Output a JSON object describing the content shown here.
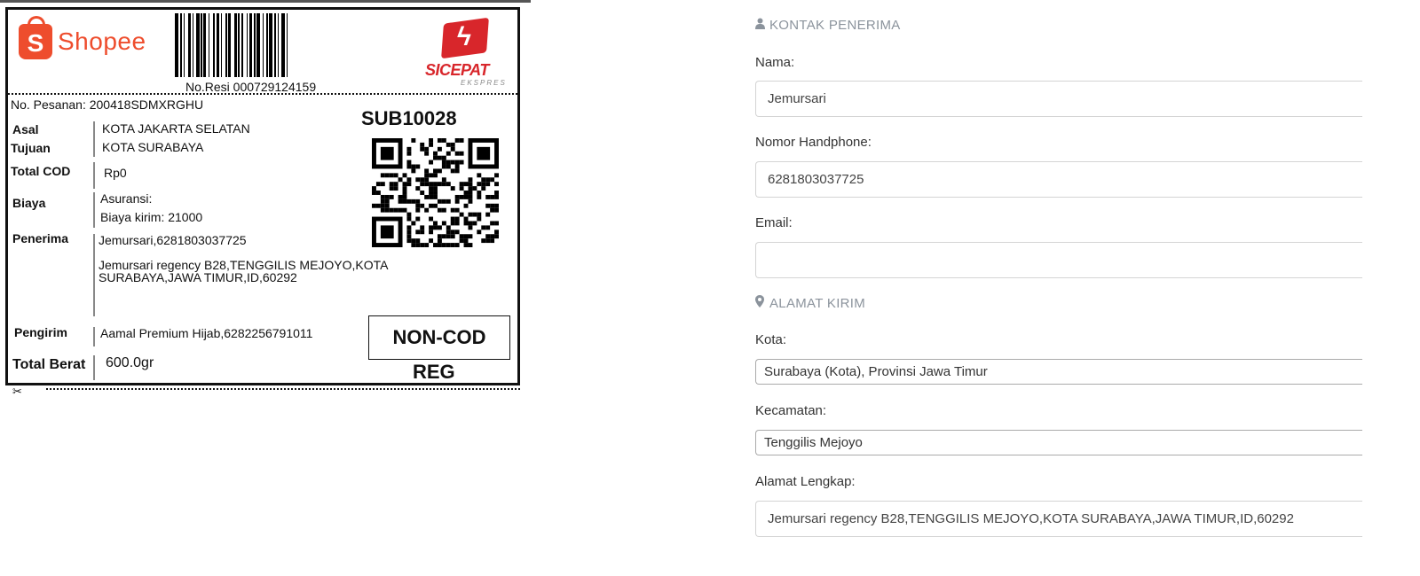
{
  "label": {
    "shopee_logo_text": "Shopee",
    "shopee_logo_letter": "S",
    "resi": "No.Resi 000729124159",
    "courier_name": "SICEPAT",
    "courier_sub": "EKSPRES",
    "pesanan": "No. Pesanan: 200418SDMXRGHU",
    "sorting_code": "SUB10028",
    "asal_label": "Asal",
    "asal_value": "KOTA JAKARTA SELATAN",
    "tujuan_label": "Tujuan",
    "tujuan_value": "KOTA SURABAYA",
    "cod_label": "Total COD",
    "cod_value": "Rp0",
    "biaya_label": "Biaya",
    "asuransi": "Asuransi:",
    "biaya_kirim": "Biaya kirim: 21000",
    "penerima_label": "Penerima",
    "penerima_name": "Jemursari,6281803037725",
    "penerima_addr1": "Jemursari regency B28,TENGGILIS MEJOYO,KOTA",
    "penerima_addr2": "SURABAYA,JAWA TIMUR,ID,60292",
    "pengirim_label": "Pengirim",
    "pengirim_value": "Aamal Premium Hijab,6282256791011",
    "berat_label": "Total Berat",
    "berat_value": "600.0gr",
    "payment_type": "NON-COD",
    "service": "REG"
  },
  "form": {
    "section_contact": "KONTAK PENERIMA",
    "nama_label": "Nama:",
    "nama_value": "Jemursari",
    "hp_label": "Nomor Handphone:",
    "hp_value": "6281803037725",
    "email_label": "Email:",
    "email_value": "",
    "section_address": "ALAMAT KIRIM",
    "kota_label": "Kota:",
    "kota_value": "Surabaya (Kota), Provinsi Jawa Timur",
    "kecamatan_label": "Kecamatan:",
    "kecamatan_value": "Tenggilis Mejoyo",
    "alamat_label": "Alamat Lengkap:",
    "alamat_value": "Jemursari regency B28,TENGGILIS MEJOYO,KOTA SURABAYA,JAWA TIMUR,ID,60292"
  },
  "icons": {
    "contact": "user-icon",
    "address": "map-marker-icon"
  }
}
